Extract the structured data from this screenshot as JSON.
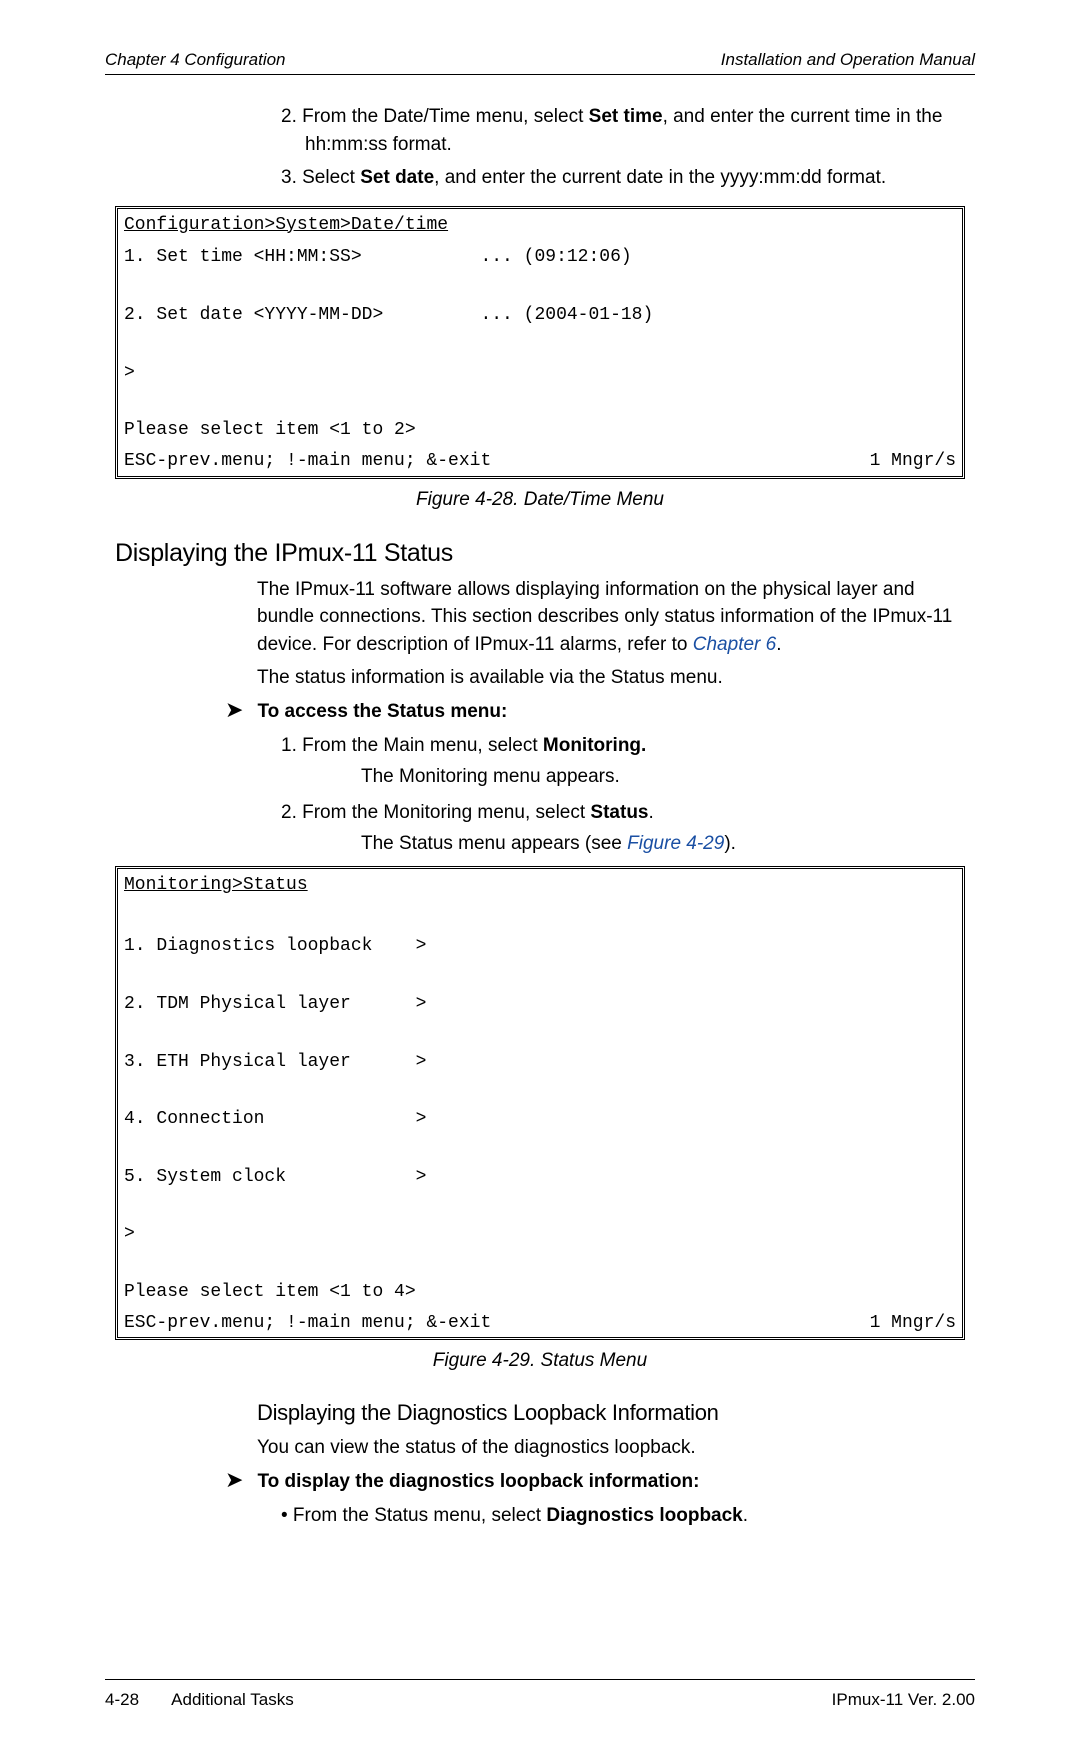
{
  "header": {
    "left": "Chapter 4  Configuration",
    "right": "Installation and Operation Manual"
  },
  "top_steps": {
    "s2_prefix": "2.   From the Date/Time menu, select ",
    "s2_bold": "Set time",
    "s2_suffix": ", and enter the current time in the hh:mm:ss format.",
    "s3_prefix": "3.   Select ",
    "s3_bold": "Set date",
    "s3_suffix": ", and enter the current date in the yyyy:mm:dd format."
  },
  "term1": {
    "breadcrumb": "Configuration>System>Date/time",
    "body": "1. Set time <HH:MM:SS>           ... (09:12:06)\n\n2. Set date <YYYY-MM-DD>         ... (2004-01-18)\n\n>\n\nPlease select item <1 to 2>",
    "esc": "ESC-prev.menu; !-main menu; &-exit",
    "mngr": "1 Mngr/s"
  },
  "caption1": "Figure 4-28.  Date/Time Menu",
  "section_title": "Displaying the IPmux-11 Status",
  "section_para1_a": "The IPmux-11 software allows displaying information on the physical layer and bundle connections. This section describes only status information of the IPmux-11 device. For description of IPmux-11 alarms, refer to ",
  "section_para1_link": "Chapter 6",
  "section_para1_b": ".",
  "section_para2": "The status information is available via the Status menu.",
  "proc1": {
    "title": "To access the Status menu:",
    "s1_pre": "1.   From the Main menu, select ",
    "s1_bold": "Monitoring.",
    "s1_result": "The Monitoring menu appears.",
    "s2_pre": "2.   From the Monitoring menu, select ",
    "s2_bold": "Status",
    "s2_post": ".",
    "s2_result_a": "The Status menu appears (see ",
    "s2_result_link": "Figure 4-29",
    "s2_result_b": ")."
  },
  "term2": {
    "breadcrumb": "Monitoring>Status",
    "body": "\n1. Diagnostics loopback    >\n\n2. TDM Physical layer      >\n\n3. ETH Physical layer      >\n\n4. Connection              >\n\n5. System clock            >\n\n>\n\nPlease select item <1 to 4>",
    "esc": "ESC-prev.menu; !-main menu; &-exit",
    "mngr": "1 Mngr/s"
  },
  "caption2": "Figure 4-29.  Status Menu",
  "sub_title": "Displaying the Diagnostics Loopback Information",
  "sub_para": "You can view the status of the diagnostics loopback.",
  "proc2": {
    "title": "To display the diagnostics loopback information:",
    "b1_pre": "•    From the Status menu, select ",
    "b1_bold": "Diagnostics loopback",
    "b1_post": "."
  },
  "footer": {
    "left_page": "4-28",
    "left_label": "Additional Tasks",
    "right": "IPmux-11 Ver. 2.00"
  }
}
